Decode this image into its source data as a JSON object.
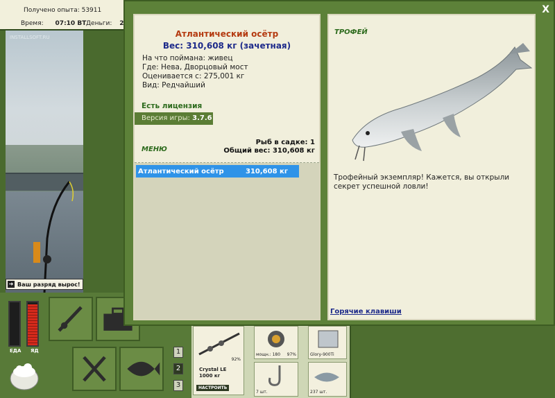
{
  "topbar": {
    "experience": "Получено опыта: 53911",
    "time_label": "Время:",
    "time_value": "07:10 ВТ",
    "money_label": "Деньги:",
    "money_value": "2"
  },
  "viewport": {
    "watermark": "INSTALLSOFT.RU"
  },
  "toast": {
    "text": "Ваш разряд вырос!"
  },
  "meters": {
    "food_label": "ЕДА",
    "food_level": 0.0,
    "poison_label": "ЯД",
    "poison_level": 0.95
  },
  "pages": [
    "1",
    "2",
    "3"
  ],
  "inventory": {
    "rod_name": "Crystal LE",
    "rod_cap": "1000 кг",
    "rod_pct": "92%",
    "setup_button": "НАСТРОИТЬ",
    "reel_power": "мощн.: 180",
    "reel_pct": "97%",
    "line_name": "Glory-900Ti",
    "hook_count": "7 шт.",
    "bait_count": "237 шт."
  },
  "modal": {
    "close": "X",
    "fish_name": "Атлантический осётр",
    "fish_weight": "Вес: 310,608 кг (зачетная)",
    "caught_with": "На что поймана: живец",
    "location": "Где: Нева, Дворцовый мост",
    "valued_from": "Оценивается с: 275,001 кг",
    "kind": "Вид: Редчайший",
    "license": "Есть лицензия",
    "version_label": "Версия игры: ",
    "version_value": "3.7.6",
    "menu": "МЕНЮ",
    "keep_count": "Рыб в садке: 1",
    "keep_weight": "Общий вес: 310,608 кг",
    "catches": [
      {
        "name": "Атлантический осётр",
        "weight": "310,608 кг"
      }
    ],
    "trophy_label": "ТРОФЕЙ",
    "trophy_text": "Трофейный экземпляр! Кажется, вы открыли секрет успешной ловли!",
    "hotkeys": "Горячие клавиши"
  }
}
